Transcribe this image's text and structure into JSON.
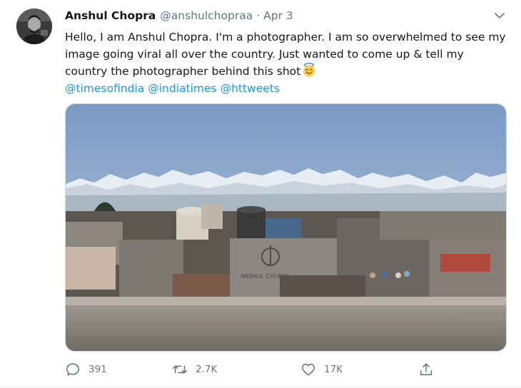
{
  "user": {
    "display_name": "Anshul Chopra",
    "handle": "@anshulchopraa",
    "separator": "·",
    "date": "Apr 3"
  },
  "tweet": {
    "text": "Hello, I am Anshul Chopra. I'm a photographer. I am so overwhelmed to see my image going viral all over the country. Just wanted to come up & tell my country the photographer behind this shot",
    "emoji": "smiling-face-with-halo",
    "mentions": [
      "@timesofindia",
      "@indiatimes",
      "@httweets"
    ]
  },
  "media": {
    "watermark": "ANSHUL CHOPRA"
  },
  "actions": {
    "replies": "391",
    "retweets": "2.7K",
    "likes": "17K"
  },
  "colors": {
    "link": "#1b95e0",
    "secondary_text": "#657786",
    "primary_text": "#14171a"
  }
}
